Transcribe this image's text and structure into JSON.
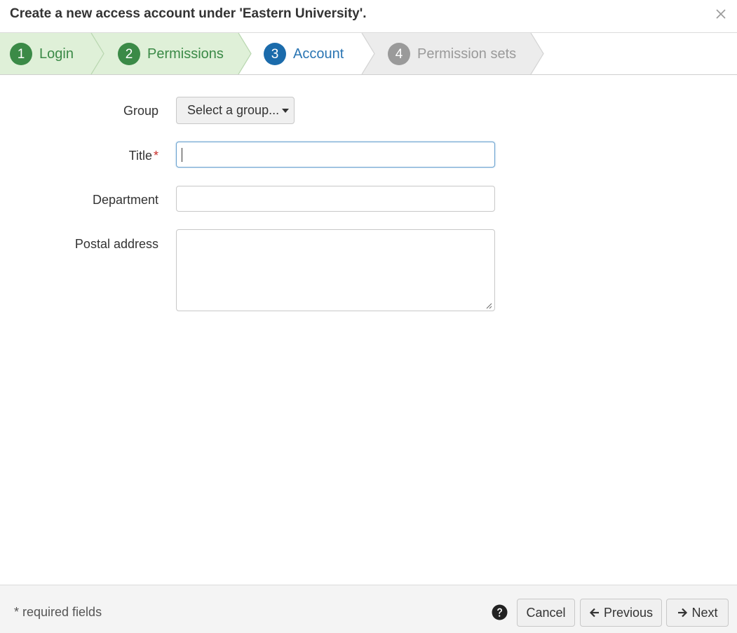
{
  "header": {
    "title": "Create a new access account under 'Eastern University'."
  },
  "steps": [
    {
      "number": "1",
      "label": "Login",
      "state": "done"
    },
    {
      "number": "2",
      "label": "Permissions",
      "state": "done"
    },
    {
      "number": "3",
      "label": "Account",
      "state": "active"
    },
    {
      "number": "4",
      "label": "Permission sets",
      "state": "todo"
    }
  ],
  "form": {
    "group": {
      "label": "Group",
      "button_label": "Select a group..."
    },
    "title": {
      "label": "Title",
      "required_marker": "*",
      "value": ""
    },
    "department": {
      "label": "Department",
      "value": ""
    },
    "postal_address": {
      "label": "Postal address",
      "value": ""
    }
  },
  "footer": {
    "required_note": "* required fields",
    "cancel_label": "Cancel",
    "previous_label": "Previous",
    "next_label": "Next"
  },
  "colors": {
    "step_done": "#3b8a47",
    "step_done_bg": "#dff0d8",
    "step_active": "#1b6bab",
    "step_todo": "#9a9a9a",
    "step_todo_bg": "#ececec",
    "required": "#c9302c"
  },
  "icons": {
    "close": "close-icon",
    "help": "question-circle-icon",
    "previous": "arrow-left-icon",
    "next": "arrow-right-icon",
    "dropdown": "caret-down-icon"
  }
}
